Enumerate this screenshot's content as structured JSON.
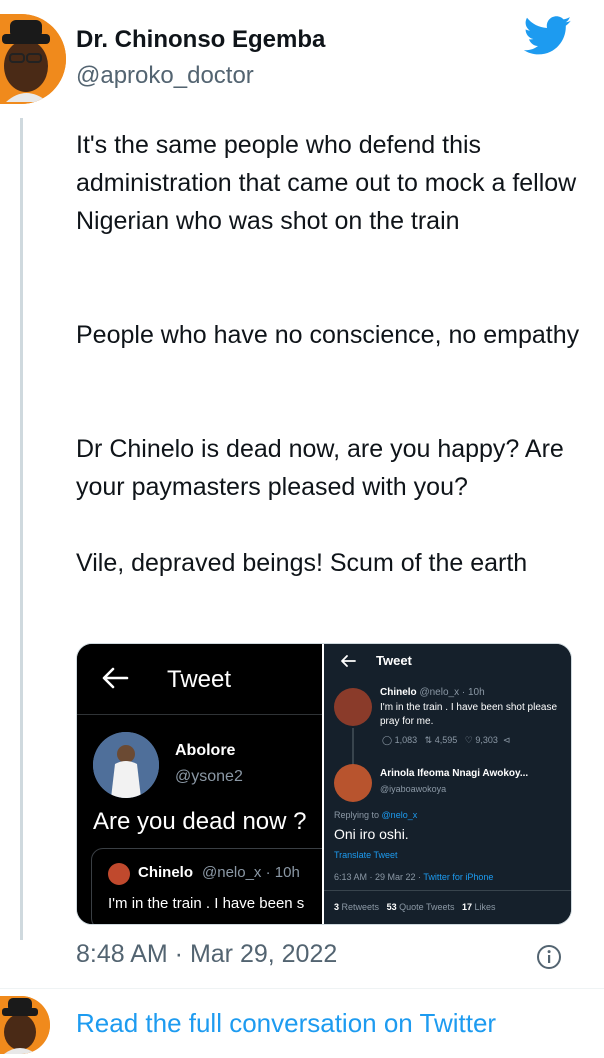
{
  "author": {
    "name": "Dr. Chinonso Egemba",
    "handle": "@aproko_doctor"
  },
  "tweet": {
    "paragraphs": [
      "It's the same people who defend this administration that came out to mock a fellow Nigerian who was shot on the train",
      "People who have no conscience, no empathy",
      "Dr Chinelo is dead now, are you happy? Are your paymasters pleased with you?",
      "Vile, depraved beings! Scum of the earth"
    ],
    "timestamp": "8:48 AM · Mar 29, 2022"
  },
  "left_screenshot": {
    "header_title": "Tweet",
    "user_name": "Abolore",
    "user_handle": "@ysone2",
    "text": "Are you dead now ?",
    "quoted_name": "Chinelo",
    "quoted_meta": "@nelo_x · 10h",
    "quoted_text": "I'm in the train .  I have been s"
  },
  "right_screenshot": {
    "header_title": "Tweet",
    "first": {
      "name": "Chinelo",
      "meta": "@nelo_x · 10h",
      "text": "I'm in the train .  I have been shot please pray for me.",
      "replies": "1,083",
      "retweets": "4,595",
      "likes": "9,303"
    },
    "second": {
      "name": "Arinola Ifeoma Nnagi Awokoy...",
      "handle": "@iyaboawokoya",
      "replying_prefix": "Replying to",
      "replying_handle": "@nelo_x",
      "text": "Oni iro oshi.",
      "translate": "Translate Tweet",
      "time": "6:13 AM · 29 Mar 22 · ",
      "source": "Twitter for iPhone"
    },
    "stats": {
      "retweets_count": "3",
      "retweets_label": "Retweets",
      "quotes_count": "53",
      "quotes_label": "Quote Tweets",
      "likes_count": "17",
      "likes_label": "Likes"
    }
  },
  "footer": {
    "read_more": "Read the full conversation on Twitter"
  },
  "colors": {
    "brand_blue": "#1d9bf0",
    "muted": "#536471",
    "dim_bg": "#15202b"
  },
  "icons": [
    "twitter-bird-icon",
    "info-icon",
    "back-arrow-icon",
    "reply-icon",
    "retweet-icon",
    "like-icon",
    "share-icon"
  ]
}
